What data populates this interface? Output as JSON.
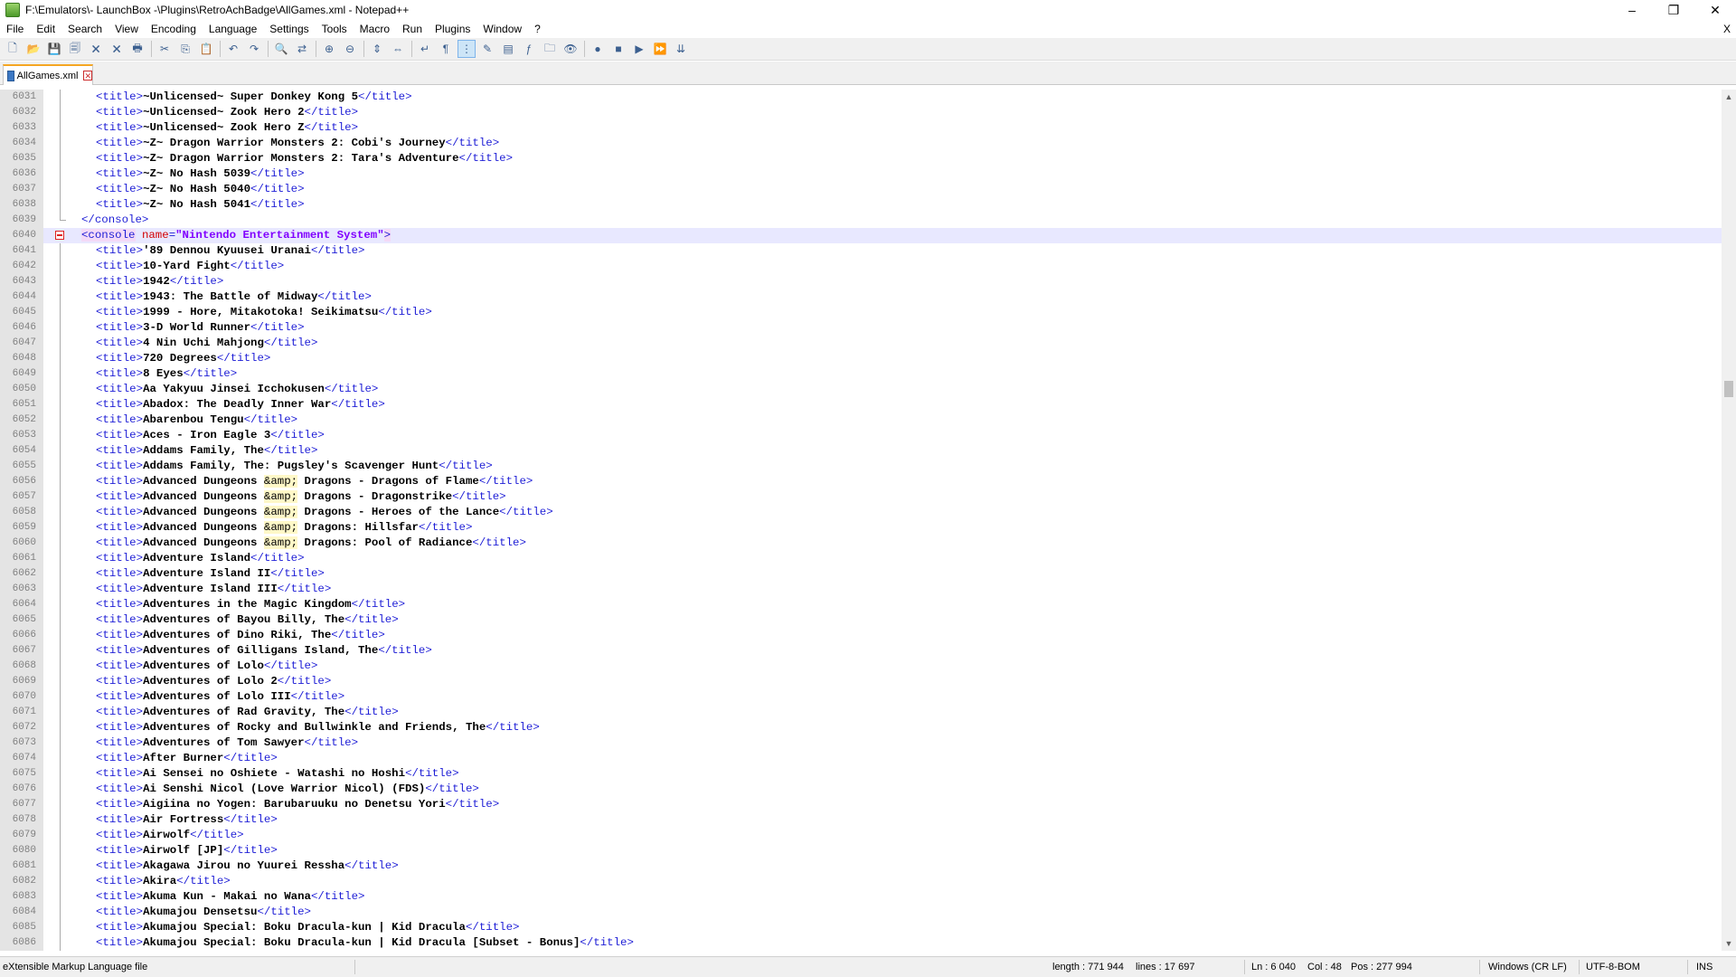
{
  "window": {
    "title": "F:\\Emulators\\- LaunchBox -\\Plugins\\RetroAchBadge\\AllGames.xml - Notepad++",
    "minimize_glyph": "–",
    "maximize_glyph": "❐",
    "close_glyph": "✕"
  },
  "menu": {
    "items": [
      "File",
      "Edit",
      "Search",
      "View",
      "Encoding",
      "Language",
      "Settings",
      "Tools",
      "Macro",
      "Run",
      "Plugins",
      "Window",
      "?"
    ],
    "close_label": "X"
  },
  "toolbar": {
    "groups": [
      [
        "new-file-icon",
        "open-file-icon",
        "save-icon",
        "save-all-icon",
        "close-icon",
        "close-all-icon",
        "print-icon"
      ],
      [
        "cut-icon",
        "copy-icon",
        "paste-icon"
      ],
      [
        "undo-icon",
        "redo-icon"
      ],
      [
        "find-icon",
        "replace-icon"
      ],
      [
        "zoom-in-icon",
        "zoom-out-icon"
      ],
      [
        "sync-vertical-icon",
        "sync-horizontal-icon"
      ],
      [
        "word-wrap-icon",
        "show-all-chars-icon",
        "indent-guide-icon",
        "udl-icon",
        "doc-map-icon",
        "function-list-icon",
        "folder-workspace-icon",
        "monitoring-icon"
      ],
      [
        "record-macro-icon",
        "stop-macro-icon",
        "play-macro-icon",
        "play-multiple-icon",
        "save-macro-icon"
      ]
    ],
    "glyphs": {
      "new-file-icon": "🗋",
      "open-file-icon": "📂",
      "save-icon": "💾",
      "save-all-icon": "🗐",
      "close-icon": "🗙",
      "close-all-icon": "🗙",
      "print-icon": "🖶",
      "cut-icon": "✂",
      "copy-icon": "⎘",
      "paste-icon": "📋",
      "undo-icon": "↶",
      "redo-icon": "↷",
      "find-icon": "🔍",
      "replace-icon": "⇄",
      "zoom-in-icon": "⊕",
      "zoom-out-icon": "⊖",
      "sync-vertical-icon": "⇕",
      "sync-horizontal-icon": "⇔",
      "word-wrap-icon": "↵",
      "show-all-chars-icon": "¶",
      "indent-guide-icon": "⋮",
      "udl-icon": "✎",
      "doc-map-icon": "▤",
      "function-list-icon": "ƒ",
      "folder-workspace-icon": "🗀",
      "monitoring-icon": "👁",
      "record-macro-icon": "●",
      "stop-macro-icon": "■",
      "play-macro-icon": "▶",
      "play-multiple-icon": "⏩",
      "save-macro-icon": "⇊"
    },
    "active": [
      "indent-guide-icon"
    ]
  },
  "tab": {
    "label": "AllGames.xml",
    "close_glyph": "✕"
  },
  "editor": {
    "current_line": 6040,
    "lines": [
      {
        "n": "6031",
        "t": "~Unlicensed~ Super Donkey Kong 5"
      },
      {
        "n": "6032",
        "t": "~Unlicensed~ Zook Hero 2"
      },
      {
        "n": "6033",
        "t": "~Unlicensed~ Zook Hero Z"
      },
      {
        "n": "6034",
        "t": "~Z~ Dragon Warrior Monsters 2: Cobi's Journey"
      },
      {
        "n": "6035",
        "t": "~Z~ Dragon Warrior Monsters 2: Tara's Adventure"
      },
      {
        "n": "6036",
        "t": "~Z~ No Hash 5039"
      },
      {
        "n": "6037",
        "t": "~Z~ No Hash 5040"
      },
      {
        "n": "6038",
        "t": "~Z~ No Hash 5041"
      },
      {
        "n": "6039",
        "close": "console"
      },
      {
        "n": "6040",
        "open": "console",
        "attr": "name",
        "val": "\"Nintendo Entertainment System\""
      },
      {
        "n": "6041",
        "t": "'89 Dennou Kyuusei Uranai"
      },
      {
        "n": "6042",
        "t": "10-Yard Fight"
      },
      {
        "n": "6043",
        "t": "1942"
      },
      {
        "n": "6044",
        "t": "1943: The Battle of Midway"
      },
      {
        "n": "6045",
        "t": "1999 - Hore, Mitakotoka! Seikimatsu"
      },
      {
        "n": "6046",
        "t": "3-D World Runner"
      },
      {
        "n": "6047",
        "t": "4 Nin Uchi Mahjong"
      },
      {
        "n": "6048",
        "t": "720 Degrees"
      },
      {
        "n": "6049",
        "t": "8 Eyes"
      },
      {
        "n": "6050",
        "t": "Aa Yakyuu Jinsei Icchokusen"
      },
      {
        "n": "6051",
        "t": "Abadox: The Deadly Inner War"
      },
      {
        "n": "6052",
        "t": "Abarenbou Tengu"
      },
      {
        "n": "6053",
        "t": "Aces - Iron Eagle 3"
      },
      {
        "n": "6054",
        "t": "Addams Family, The"
      },
      {
        "n": "6055",
        "t": "Addams Family, The: Pugsley's Scavenger Hunt"
      },
      {
        "n": "6056",
        "t": "Advanced Dungeons ",
        "e": "&amp;",
        "t2": " Dragons - Dragons of Flame"
      },
      {
        "n": "6057",
        "t": "Advanced Dungeons ",
        "e": "&amp;",
        "t2": " Dragons - Dragonstrike"
      },
      {
        "n": "6058",
        "t": "Advanced Dungeons ",
        "e": "&amp;",
        "t2": " Dragons - Heroes of the Lance"
      },
      {
        "n": "6059",
        "t": "Advanced Dungeons ",
        "e": "&amp;",
        "t2": " Dragons: Hillsfar"
      },
      {
        "n": "6060",
        "t": "Advanced Dungeons ",
        "e": "&amp;",
        "t2": " Dragons: Pool of Radiance"
      },
      {
        "n": "6061",
        "t": "Adventure Island"
      },
      {
        "n": "6062",
        "t": "Adventure Island II"
      },
      {
        "n": "6063",
        "t": "Adventure Island III"
      },
      {
        "n": "6064",
        "t": "Adventures in the Magic Kingdom"
      },
      {
        "n": "6065",
        "t": "Adventures of Bayou Billy, The"
      },
      {
        "n": "6066",
        "t": "Adventures of Dino Riki, The"
      },
      {
        "n": "6067",
        "t": "Adventures of Gilligans Island, The"
      },
      {
        "n": "6068",
        "t": "Adventures of Lolo"
      },
      {
        "n": "6069",
        "t": "Adventures of Lolo 2"
      },
      {
        "n": "6070",
        "t": "Adventures of Lolo III"
      },
      {
        "n": "6071",
        "t": "Adventures of Rad Gravity, The"
      },
      {
        "n": "6072",
        "t": "Adventures of Rocky and Bullwinkle and Friends, The"
      },
      {
        "n": "6073",
        "t": "Adventures of Tom Sawyer"
      },
      {
        "n": "6074",
        "t": "After Burner"
      },
      {
        "n": "6075",
        "t": "Ai Sensei no Oshiete - Watashi no Hoshi"
      },
      {
        "n": "6076",
        "t": "Ai Senshi Nicol (Love Warrior Nicol) (FDS)"
      },
      {
        "n": "6077",
        "t": "Aigiina no Yogen: Barubaruuku no Denetsu Yori"
      },
      {
        "n": "6078",
        "t": "Air Fortress"
      },
      {
        "n": "6079",
        "t": "Airwolf"
      },
      {
        "n": "6080",
        "t": "Airwolf [JP]"
      },
      {
        "n": "6081",
        "t": "Akagawa Jirou no Yuurei Ressha"
      },
      {
        "n": "6082",
        "t": "Akira"
      },
      {
        "n": "6083",
        "t": "Akuma Kun - Makai no Wana"
      },
      {
        "n": "6084",
        "t": "Akumajou Densetsu"
      },
      {
        "n": "6085",
        "t": "Akumajou Special: Boku Dracula-kun | Kid Dracula"
      },
      {
        "n": "6086",
        "t": "Akumajou Special: Boku Dracula-kun | Kid Dracula [Subset - Bonus]"
      }
    ]
  },
  "statusbar": {
    "file_type": "eXtensible Markup Language file",
    "length": "length : 771 944",
    "lines": "lines : 17 697",
    "ln": "Ln : 6 040",
    "col": "Col : 48",
    "pos": "Pos : 277 994",
    "eol": "Windows (CR LF)",
    "encoding": "UTF-8-BOM",
    "mode": "INS"
  },
  "colors": {
    "tag": "#1e1ed6",
    "attr": "#d20000",
    "value": "#8000ff",
    "current_line": "#e8e8ff",
    "tab_accent": "#f5a623"
  }
}
